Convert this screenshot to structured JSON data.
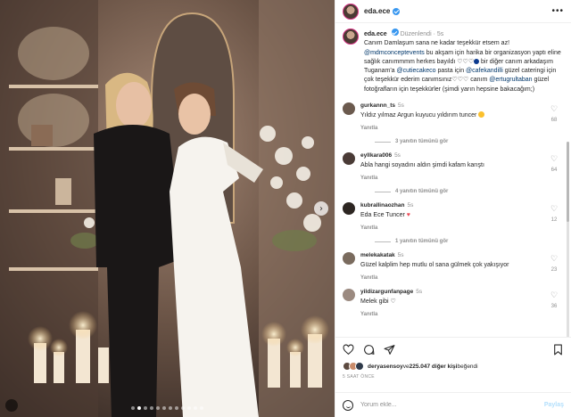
{
  "header": {
    "username": "eda.ece",
    "more_icon": "more-horizontal-icon"
  },
  "caption": {
    "username": "eda.ece",
    "edited": "Düzenlendi",
    "sep": "·",
    "time": "5s",
    "t1": "Canım Damlaşum sana ne kadar teşekkür etsem az! ",
    "m1": "@mdmconceptevents",
    "t2": " bu akşam için harika bir organizasyon yaptı eline sağlık canımmmm herkes bayıldı ",
    "t3": " bir diğer canım arkadaşım Tuganam'a ",
    "m2": "@cutiecakeco",
    "t4": " pasta için ",
    "m3": "@cafekandilli",
    "t5": " güzel cateringi için çok teşekkür ederim canımsınız",
    "t6": " canım ",
    "m4": "@ertugrultaban",
    "t7": " güzel fotoğrafların için teşekkürler (şimdi yarın hepsine bakacağım;)"
  },
  "comments": [
    {
      "user": "gurkannn_ts",
      "time": "5s",
      "text": "Yıldız yılmaz Argun kuyucu yıldırım tuncer",
      "reply": "Yanıtla",
      "likes": "68",
      "replies": "3 yanıtın tümünü gör",
      "color": "#6b5a4e"
    },
    {
      "user": "eyllkara006",
      "time": "5s",
      "text": "Abla hangi soyadını aldın şimdi kafam karıştı",
      "reply": "Yanıtla",
      "likes": "64",
      "replies": "4 yanıtın tümünü gör",
      "color": "#4a3b36"
    },
    {
      "user": "kubrallinaozhan",
      "time": "5s",
      "text": "Eda Ece Tuncer ",
      "reply": "Yanıtla",
      "likes": "12",
      "replies": "1 yanıtın tümünü gör",
      "color": "#2d2622"
    },
    {
      "user": "melekakatak",
      "time": "5s",
      "text": "Güzel kalplim hep mutlu ol sana gülmek çok yakışıyor",
      "reply": "Yanıtla",
      "likes": "23",
      "replies": "",
      "color": "#7a6b5e"
    },
    {
      "user": "yildizargunfanpage",
      "time": "5s",
      "text": "Melek gibi ",
      "reply": "Yanıtla",
      "likes": "36",
      "replies": "",
      "color": "#9b8a80"
    }
  ],
  "likes": {
    "user": "deryasensoy",
    "connector": " ve ",
    "count": "225.047 diğer kişi",
    "suffix": " beğendi"
  },
  "time_ago": "5 SAAT ÖNCE",
  "add_comment": {
    "placeholder": "Yorum ekle...",
    "post_label": "Paylaş"
  },
  "carousel": {
    "count": 12,
    "active": 1
  }
}
